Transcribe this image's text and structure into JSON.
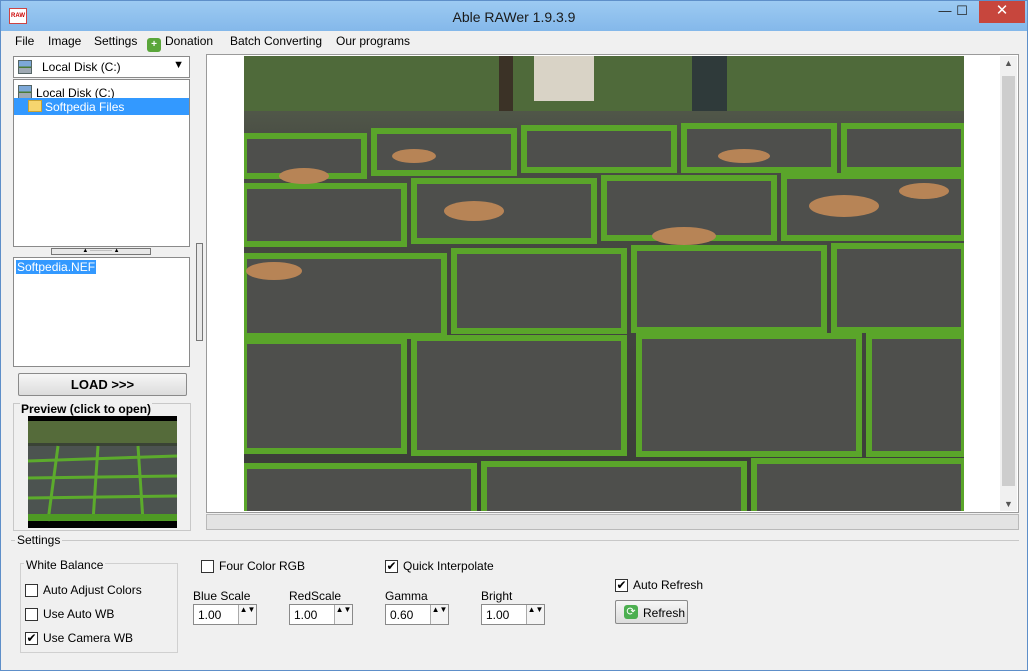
{
  "window": {
    "title": "Able RAWer 1.9.3.9",
    "app_icon_text": "RAW"
  },
  "menu": {
    "items": [
      "File",
      "Image",
      "Settings",
      "Donation",
      "Batch Converting",
      "Our programs"
    ]
  },
  "drive_select": {
    "value": "Local Disk (C:)"
  },
  "tree": {
    "root": "Local Disk (C:)",
    "selected": "Softpedia Files"
  },
  "files": {
    "items": [
      "Softpedia.NEF"
    ]
  },
  "load_button": "LOAD >>>",
  "preview": {
    "label": "Preview (click to open)"
  },
  "settings": {
    "label": "Settings",
    "white_balance": {
      "label": "White Balance",
      "options": [
        {
          "label": "Auto Adjust Colors",
          "checked": false
        },
        {
          "label": "Use Auto WB",
          "checked": false
        },
        {
          "label": "Use Camera WB",
          "checked": true
        }
      ]
    },
    "four_color_rgb": {
      "label": "Four Color RGB",
      "checked": false
    },
    "quick_interpolate": {
      "label": "Quick Interpolate",
      "checked": true
    },
    "auto_refresh": {
      "label": "Auto Refresh",
      "checked": true
    },
    "fields": [
      {
        "label": "Blue Scale",
        "value": "1.00"
      },
      {
        "label": "RedScale",
        "value": "1.00"
      },
      {
        "label": "Gamma",
        "value": "0.60"
      },
      {
        "label": "Bright",
        "value": "1.00"
      }
    ],
    "refresh_button": "Refresh"
  },
  "icons": {
    "check": "✔",
    "close": "✕",
    "maximize": "☐",
    "minimize": "—",
    "dropdown": "▼",
    "scroll_up": "▲",
    "scroll_down": "▼",
    "spin": "▲▼",
    "donation": "+",
    "refresh": "⟳"
  }
}
